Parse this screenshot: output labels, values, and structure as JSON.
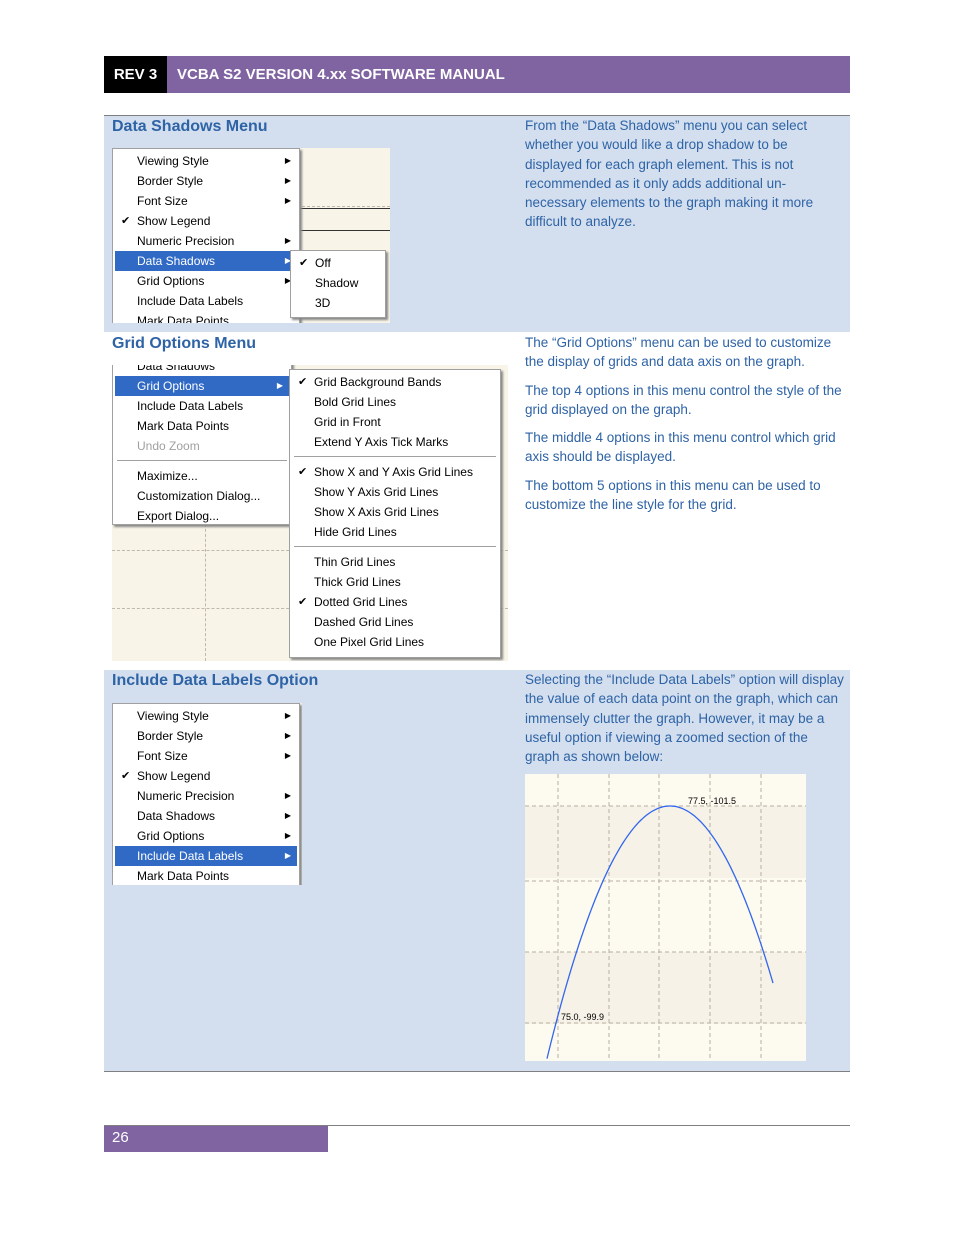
{
  "header": {
    "rev": "REV 3",
    "title": "VCBA S2 VERSION 4.xx SOFTWARE MANUAL"
  },
  "sections": [
    {
      "title": "Data Shadows Menu",
      "paragraphs": [
        "From the “Data Shadows” menu you can select whether you would like a drop shadow to be displayed for each graph element. This is not recommended as it only adds additional un-necessary elements to the graph making it more difficult to analyze."
      ]
    },
    {
      "title": "Grid Options Menu",
      "paragraphs": [
        "The “Grid Options” menu can be used to customize the display of grids and data axis on the graph.",
        "The top 4 options in this menu control the style of the grid displayed on the graph.",
        "The middle 4 options in this menu control which grid axis should be displayed.",
        "The bottom 5 options in this menu can be used to customize the line style for the grid."
      ]
    },
    {
      "title": "Include Data Labels Option",
      "paragraphs": [
        "Selecting the “Include Data Labels” option will display the value of each data point on the graph, which can immensely clutter the graph. However, it may be a useful option if viewing a zoomed section of the graph as shown below:"
      ]
    }
  ],
  "menus": {
    "shadows_main": [
      {
        "label": "Viewing Style",
        "arrow": true
      },
      {
        "label": "Border Style",
        "arrow": true
      },
      {
        "label": "Font Size",
        "arrow": true
      },
      {
        "label": "Show Legend",
        "check": true
      },
      {
        "label": "Numeric Precision",
        "arrow": true
      },
      {
        "label": "Data Shadows",
        "arrow": true,
        "hl": true
      },
      {
        "label": "Grid Options",
        "arrow": true
      },
      {
        "label": "Include Data Labels"
      },
      {
        "label": "Mark Data Points"
      }
    ],
    "shadows_sub": [
      {
        "label": "Off",
        "check": true
      },
      {
        "label": "Shadow"
      },
      {
        "label": "3D"
      }
    ],
    "grid_main": [
      {
        "label": "Data Shadows"
      },
      {
        "label": "Grid Options",
        "arrow": true,
        "hl": true
      },
      {
        "label": "Include Data Labels"
      },
      {
        "label": "Mark Data Points"
      },
      {
        "label": "Undo Zoom",
        "dis": true
      },
      {
        "sep": true
      },
      {
        "label": "Maximize..."
      },
      {
        "label": "Customization Dialog..."
      },
      {
        "label": "Export Dialog..."
      }
    ],
    "grid_sub": [
      {
        "label": "Grid Background Bands",
        "check": true
      },
      {
        "label": "Bold Grid Lines"
      },
      {
        "label": "Grid in Front"
      },
      {
        "label": "Extend Y Axis Tick Marks"
      },
      {
        "sep": true
      },
      {
        "label": "Show X and Y Axis Grid Lines",
        "check": true
      },
      {
        "label": "Show Y Axis Grid Lines"
      },
      {
        "label": "Show X Axis Grid Lines"
      },
      {
        "label": "Hide Grid Lines"
      },
      {
        "sep": true
      },
      {
        "label": "Thin Grid Lines"
      },
      {
        "label": "Thick Grid Lines"
      },
      {
        "label": "Dotted Grid Lines",
        "check": true
      },
      {
        "label": "Dashed Grid Lines"
      },
      {
        "label": "One Pixel Grid Lines"
      }
    ],
    "labels_main": [
      {
        "label": "Viewing Style",
        "arrow": true
      },
      {
        "label": "Border Style",
        "arrow": true
      },
      {
        "label": "Font Size",
        "arrow": true
      },
      {
        "label": "Show Legend",
        "check": true
      },
      {
        "label": "Numeric Precision",
        "arrow": true
      },
      {
        "label": "Data Shadows",
        "arrow": true
      },
      {
        "label": "Grid Options",
        "arrow": true
      },
      {
        "label": "Include Data Labels",
        "arrow": true,
        "hl": true
      },
      {
        "label": "Mark Data Points"
      }
    ]
  },
  "graph": {
    "line_color": "#3366ee",
    "labels": [
      "77.5, -101.5",
      "75.0, -99.9"
    ]
  },
  "footer": {
    "page": "26"
  }
}
